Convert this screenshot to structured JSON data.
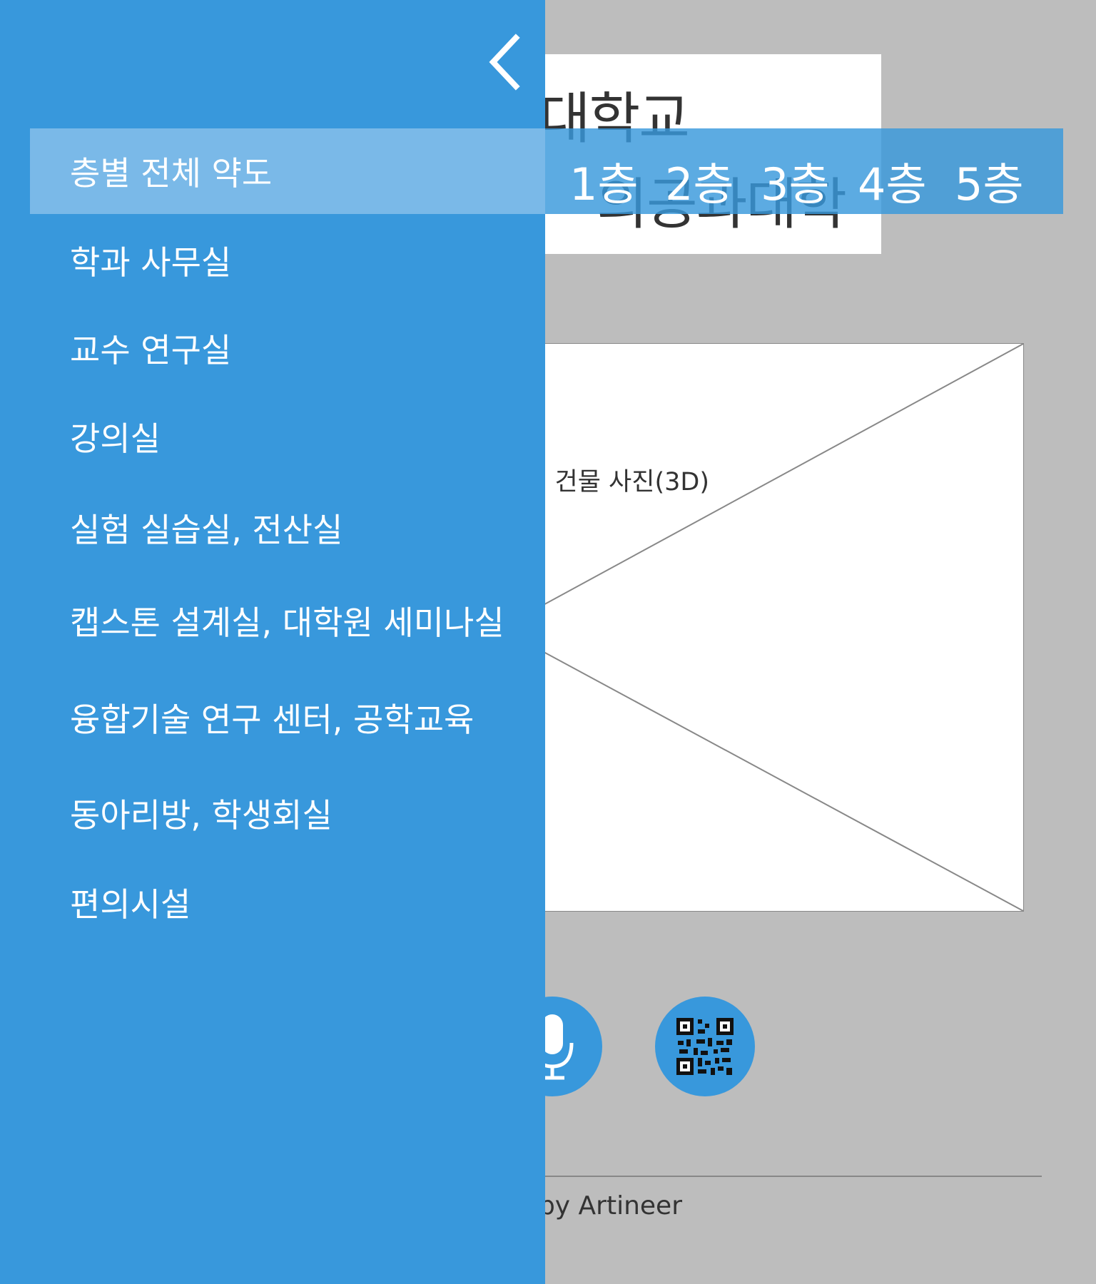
{
  "background_page": {
    "title_line1": "대학교",
    "title_line2": "의공과대학",
    "photo_caption": "건물 사진(3D)",
    "footer": "by Artineer",
    "mic_icon": "microphone-icon",
    "qr_icon": "qr-code-icon"
  },
  "drawer": {
    "back_icon": "chevron-left-icon",
    "items": [
      {
        "label": "층별 전체 약도",
        "active": true
      },
      {
        "label": "학과 사무실"
      },
      {
        "label": "교수 연구실"
      },
      {
        "label": "강의실"
      },
      {
        "label": "실험 실습실, 전산실"
      },
      {
        "label": "캡스톤 설계실, 대학원 세미나실"
      },
      {
        "label": "융합기술 연구 센터, 공학교육"
      },
      {
        "label": "동아리방, 학생회실"
      },
      {
        "label": "편의시설"
      }
    ]
  },
  "floor_tabs": [
    "1층",
    "2층",
    "3층",
    "4층",
    "5층"
  ],
  "colors": {
    "drawer": "#3898dc",
    "active_item": "#7ab9e8",
    "page_background": "#bdbdbd"
  }
}
